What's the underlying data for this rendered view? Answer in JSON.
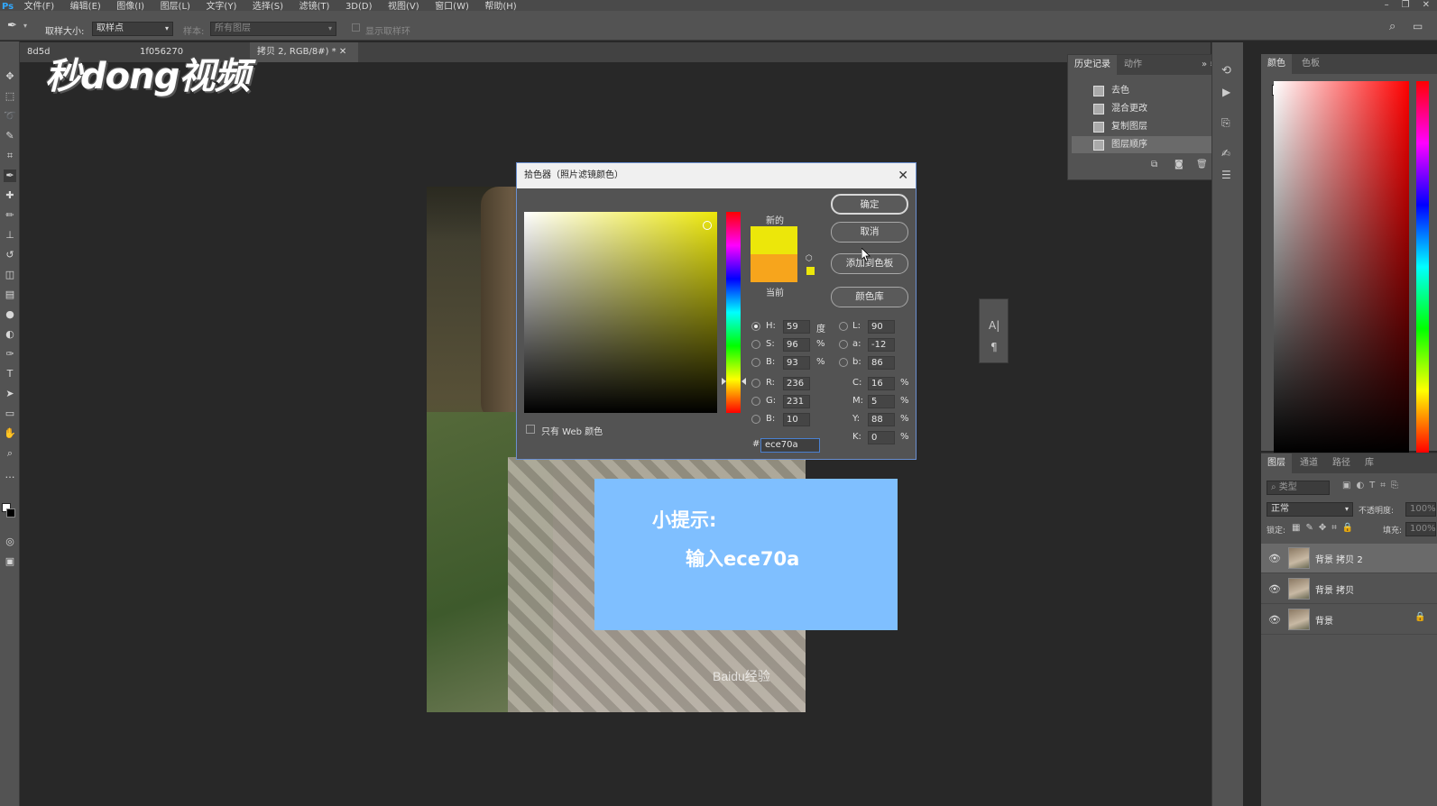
{
  "menubar": {
    "items": [
      "文件(F)",
      "编辑(E)",
      "图像(I)",
      "图层(L)",
      "文字(Y)",
      "选择(S)",
      "滤镜(T)",
      "3D(D)",
      "视图(V)",
      "窗口(W)",
      "帮助(H)"
    ]
  },
  "options_bar": {
    "sample_size_label": "取样大小:",
    "sample_size_value": "取样点",
    "sample_label": "样本:",
    "sample_value": "所有图层",
    "show_ring_label": "显示取样环"
  },
  "document_tabs": [
    {
      "label": "8d5d"
    },
    {
      "label": "1f056270"
    },
    {
      "label": "拷贝 2, RGB/8#) *"
    }
  ],
  "logo_text": "秒dong视频",
  "watermark_text": "Baidu经验",
  "tip": {
    "title": "小提示:",
    "body": "输入ece70a"
  },
  "color_picker": {
    "title": "拾色器（照片滤镜颜色）",
    "new_label": "新的",
    "current_label": "当前",
    "buttons": {
      "ok": "确定",
      "cancel": "取消",
      "add_swatch": "添加到色板",
      "color_libraries": "颜色库"
    },
    "web_only_label": "只有 Web 颜色",
    "fields": {
      "H": {
        "label": "H:",
        "value": "59",
        "unit": "度"
      },
      "S": {
        "label": "S:",
        "value": "96",
        "unit": "%"
      },
      "Bv": {
        "label": "B:",
        "value": "93",
        "unit": "%"
      },
      "R": {
        "label": "R:",
        "value": "236"
      },
      "G": {
        "label": "G:",
        "value": "231"
      },
      "Bc": {
        "label": "B:",
        "value": "10"
      },
      "L": {
        "label": "L:",
        "value": "90"
      },
      "a": {
        "label": "a:",
        "value": "-12"
      },
      "b": {
        "label": "b:",
        "value": "86"
      },
      "C": {
        "label": "C:",
        "value": "16",
        "unit": "%"
      },
      "M": {
        "label": "M:",
        "value": "5",
        "unit": "%"
      },
      "Y": {
        "label": "Y:",
        "value": "88",
        "unit": "%"
      },
      "K": {
        "label": "K:",
        "value": "0",
        "unit": "%"
      }
    },
    "hex_label": "#",
    "hex_value": "ece70a",
    "new_color": "#ece70a",
    "current_color": "#f7a51c"
  },
  "history_panel": {
    "tabs": [
      "历史记录",
      "动作"
    ],
    "items": [
      "去色",
      "混合更改",
      "复制图层",
      "图层顺序"
    ]
  },
  "color_panel": {
    "tabs": [
      "颜色",
      "色板"
    ]
  },
  "layers_panel": {
    "tabs": [
      "图层",
      "通道",
      "路径",
      "库"
    ],
    "kind_label": "类型",
    "blend_mode": "正常",
    "opacity_label": "不透明度:",
    "opacity_value": "100%",
    "lock_label": "锁定:",
    "fill_label": "填充:",
    "fill_value": "100%",
    "layers": [
      {
        "name": "背景 拷贝 2",
        "active": true
      },
      {
        "name": "背景 拷贝",
        "active": false
      },
      {
        "name": "背景",
        "active": false,
        "locked": true
      }
    ]
  }
}
